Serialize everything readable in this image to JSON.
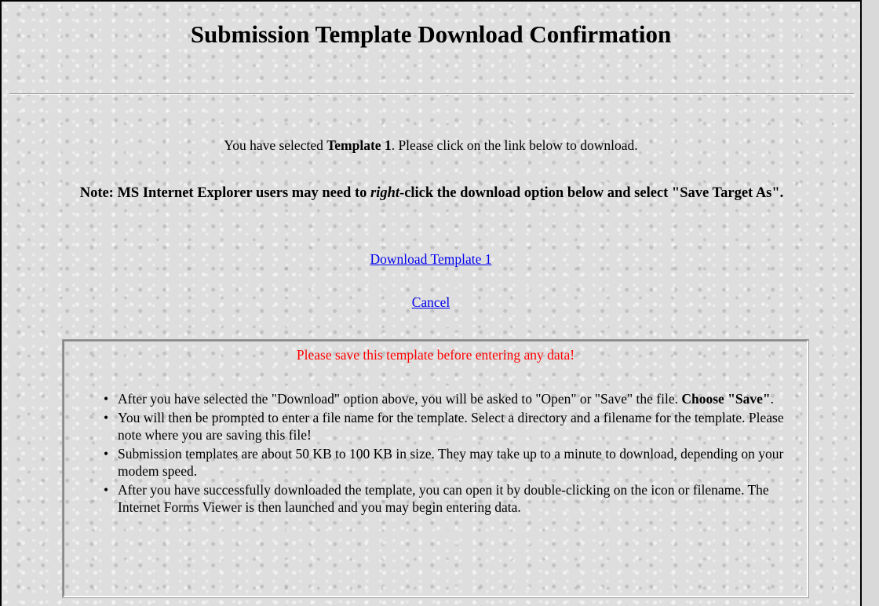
{
  "page": {
    "title": "Submission Template Download Confirmation"
  },
  "selection": {
    "prefix": "You have selected ",
    "template_name": "Template 1",
    "suffix": ".  Please click on the link below to download."
  },
  "note": {
    "part1": "Note: MS Internet Explorer users may need to ",
    "emphasis": "right",
    "part2": "-click the download option below and select \"Save Target As\"."
  },
  "links": {
    "download": "Download Template 1",
    "cancel": "Cancel"
  },
  "info_box": {
    "warning": "Please save this template before entering any data!",
    "bullet_glyph": "•",
    "items": [
      {
        "text": "After you have selected the \"Download\" option above, you will be asked to \"Open\" or \"Save\" the file.  ",
        "bold": "Choose \"Save\"",
        "tail": "."
      },
      {
        "text": "You will then be prompted to enter a file name for the template.  Select a directory and a filename for the template.  Please note where you are saving this file!"
      },
      {
        "text": "Submission templates are about 50 KB to 100 KB in size.  They may take up to a minute to download, depending on your modem speed."
      },
      {
        "text": "After you have successfully downloaded the template, you can open it by double-clicking on the icon or filename.  The Internet Forms Viewer is then launched and you may begin entering data."
      }
    ]
  },
  "colors": {
    "link": "#0000ee",
    "warning": "#ff0000",
    "background": "#dedede"
  }
}
